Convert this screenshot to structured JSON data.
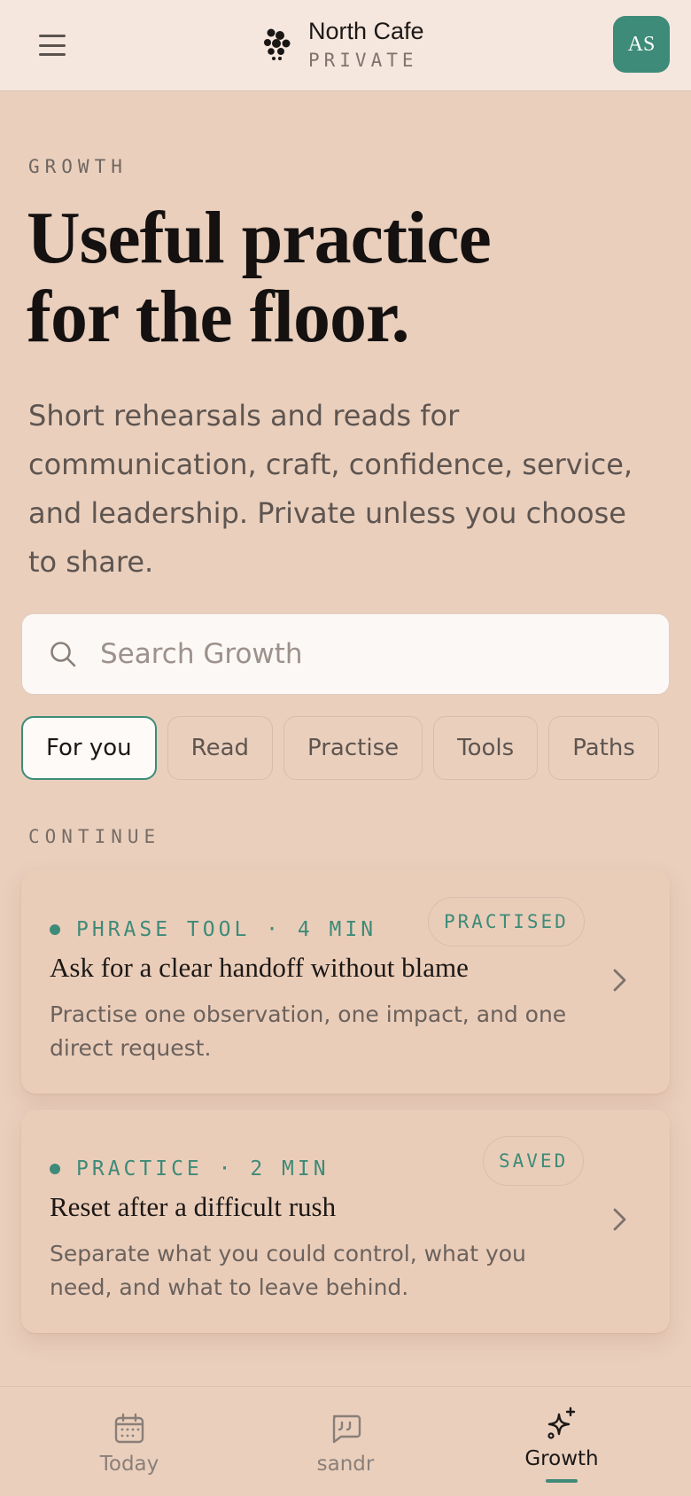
{
  "header": {
    "brand_name": "North Cafe",
    "brand_sub": "PRIVATE",
    "avatar_initials": "AS",
    "menu_icon": "hamburger-menu-icon",
    "logo_icon": "dots-cluster-logo"
  },
  "hero": {
    "eyebrow": "GROWTH",
    "title_line1": "Useful practice",
    "title_line2": "for the floor.",
    "subtitle": "Short rehearsals and reads for communication, craft, confidence, service, and leadership. Private unless you choose to share."
  },
  "search": {
    "placeholder": "Search Growth",
    "value": "",
    "icon": "search-icon"
  },
  "chips": [
    {
      "label": "For you",
      "active": true
    },
    {
      "label": "Read",
      "active": false
    },
    {
      "label": "Practise",
      "active": false
    },
    {
      "label": "Tools",
      "active": false
    },
    {
      "label": "Paths",
      "active": false
    }
  ],
  "continue_label": "CONTINUE",
  "cards": [
    {
      "meta": "PHRASE TOOL · 4 MIN",
      "badge": "PRACTISED",
      "title": "Ask for a clear handoff without blame",
      "description": "Practise one observation, one impact, and one direct request."
    },
    {
      "meta": "PRACTICE · 2 MIN",
      "badge": "SAVED",
      "title": "Reset after a difficult rush",
      "description": "Separate what you could control, what you need, and what to leave behind."
    }
  ],
  "bottom_nav": [
    {
      "label": "Today",
      "icon": "calendar-icon",
      "active": false
    },
    {
      "label": "sandr",
      "icon": "chat-quote-icon",
      "active": false
    },
    {
      "label": "Growth",
      "icon": "sparkle-icon",
      "active": true
    }
  ],
  "colors": {
    "accent": "#3d8b78",
    "background": "#eacfbd",
    "header_bg": "#f5e6de"
  }
}
